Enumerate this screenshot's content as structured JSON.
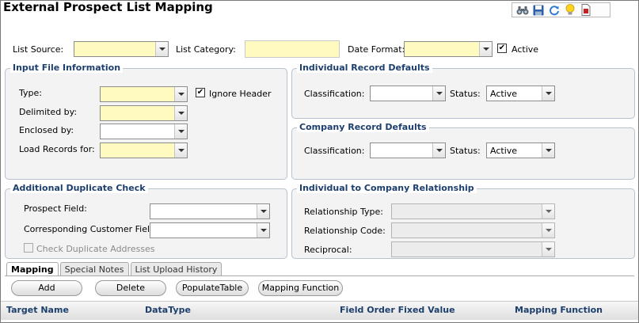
{
  "page": {
    "title": "External Prospect List Mapping"
  },
  "toolbar": {
    "icons": [
      "binoculars-icon",
      "save-icon",
      "refresh-icon",
      "lightbulb-icon",
      "report-icon"
    ]
  },
  "top": {
    "list_source_label": "List Source:",
    "list_category_label": "List Category:",
    "date_format_label": "Date Format:",
    "active_label": "Active",
    "active_checked": true
  },
  "input_file": {
    "legend": "Input File Information",
    "type_label": "Type:",
    "ignore_header_label": "Ignore Header",
    "ignore_header_checked": true,
    "delimited_label": "Delimited by:",
    "enclosed_label": "Enclosed by:",
    "load_records_label": "Load Records for:"
  },
  "individual_defaults": {
    "legend": "Individual Record Defaults",
    "classification_label": "Classification:",
    "status_label": "Status:",
    "status_value": "Active"
  },
  "company_defaults": {
    "legend": "Company Record Defaults",
    "classification_label": "Classification:",
    "status_label": "Status:",
    "status_value": "Active"
  },
  "duplicate_check": {
    "legend": "Additional Duplicate Check",
    "prospect_field_label": "Prospect Field:",
    "customer_field_label": "Corresponding Customer Field:",
    "check_duplicate_label": "Check Duplicate Addresses"
  },
  "relationship": {
    "legend": "Individual to Company Relationship",
    "type_label": "Relationship Type:",
    "code_label": "Relationship Code:",
    "reciprocal_label": "Reciprocal:"
  },
  "tabs": [
    {
      "label": "Mapping",
      "active": true
    },
    {
      "label": "Special Notes",
      "active": false
    },
    {
      "label": "List Upload History",
      "active": false
    }
  ],
  "buttons": {
    "add": "Add",
    "delete": "Delete",
    "populate": "PopulateTable",
    "mapping_function": "Mapping Function"
  },
  "grid": {
    "columns": [
      "Target Name",
      "DataType",
      "Field Order Fixed Value",
      "Mapping Function"
    ]
  },
  "colors": {
    "required": "#fffbc0",
    "legend_text": "#1d3f6d",
    "group_bg": "#f3f3f3"
  }
}
